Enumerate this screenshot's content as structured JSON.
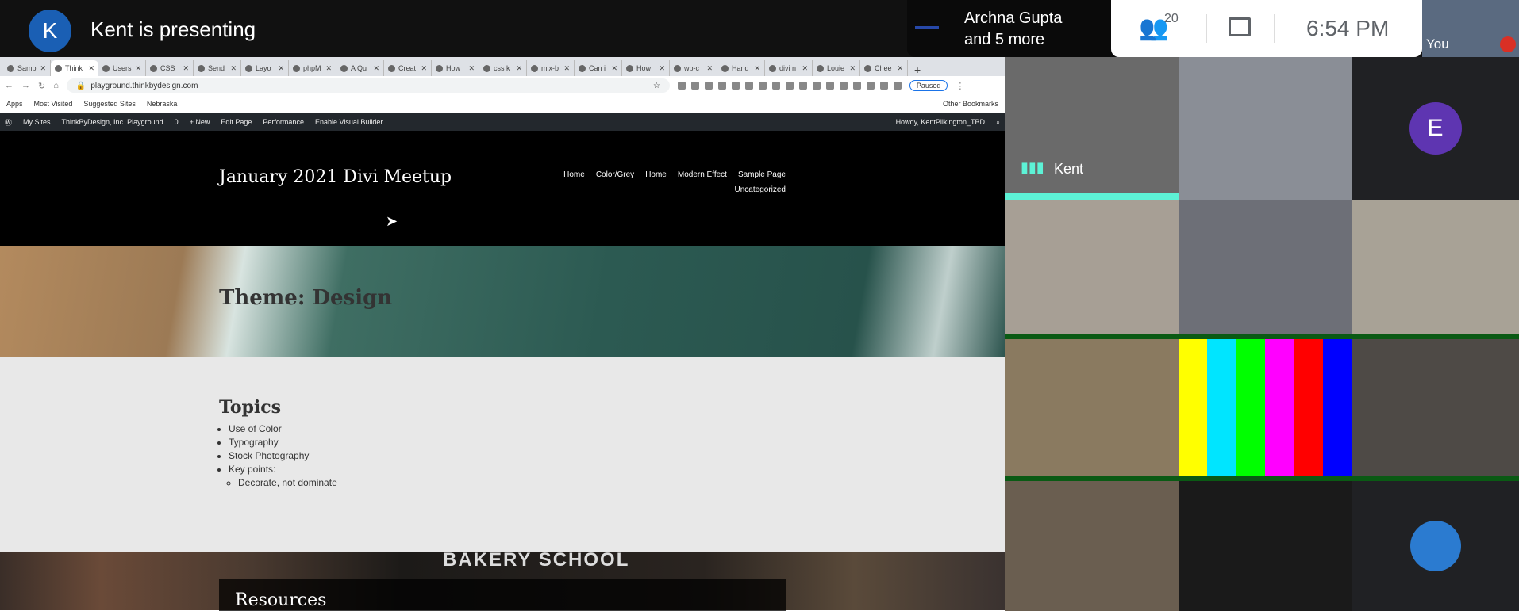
{
  "meet": {
    "presenter_initial": "K",
    "presenting_text": "Kent is presenting",
    "speaker_line1": "Archna Gupta",
    "speaker_line2": "and 5 more",
    "participant_count": "20",
    "time": "6:54  PM",
    "you_label": "You",
    "tiles": [
      {
        "label": "Kent",
        "speaking": true,
        "color": "#6a6a6a"
      },
      {
        "label": "",
        "color": "#8a8e96"
      },
      {
        "label": "",
        "initial": "E",
        "color": "#202124"
      },
      {
        "label": "",
        "color": "#a79f95"
      },
      {
        "label": "",
        "color": "#6d6f77"
      },
      {
        "label": "",
        "color": "#a8a296"
      },
      {
        "label": "",
        "color": "#8a7a60"
      },
      {
        "label": "",
        "colorbars": [
          "#ffff00",
          "#00e5ff",
          "#00ff00",
          "#ff00ff",
          "#ff0000",
          "#0000ff"
        ]
      },
      {
        "label": "",
        "color": "#4e4a46"
      },
      {
        "label": "",
        "color": "#6a5e50"
      },
      {
        "label": "",
        "color": "#1a1a1a"
      },
      {
        "label": "",
        "avatar": true,
        "color": "#202124"
      }
    ]
  },
  "browser": {
    "tabs": [
      "Samp",
      "Think",
      "Users",
      "CSS",
      "Send",
      "Layo",
      "phpM",
      "A Qu",
      "Creat",
      "How",
      "css k",
      "mix-b",
      "Can i",
      "How",
      "wp-c",
      "Hand",
      "divi n",
      "Louie",
      "Chee"
    ],
    "active_tab": 1,
    "url": "playground.thinkbydesign.com",
    "extension_status": "Paused",
    "bookmarks": [
      "Apps",
      "Most Visited",
      "Suggested Sites",
      "Nebraska"
    ],
    "other_bookmarks": "Other Bookmarks"
  },
  "wp_admin": {
    "items": [
      "My Sites",
      "ThinkByDesign, Inc. Playground",
      "0",
      "+ New",
      "Edit Page",
      "Performance",
      "Enable Visual Builder"
    ],
    "howdy": "Howdy, KentPilkington_TBD"
  },
  "site": {
    "title": "January 2021 Divi Meetup",
    "menu": [
      "Home",
      "Color/Grey",
      "Home",
      "Modern Effect",
      "Sample Page",
      "Uncategorized"
    ],
    "hero_title": "Theme: Design",
    "topics_heading": "Topics",
    "topics": [
      "Use of Color",
      "Typography",
      "Stock Photography",
      "Key points:"
    ],
    "subpoints": [
      "Decorate, not dominate"
    ],
    "bakery_sign": "BAKERY  SCHOOL",
    "resources_heading": "Resources"
  }
}
